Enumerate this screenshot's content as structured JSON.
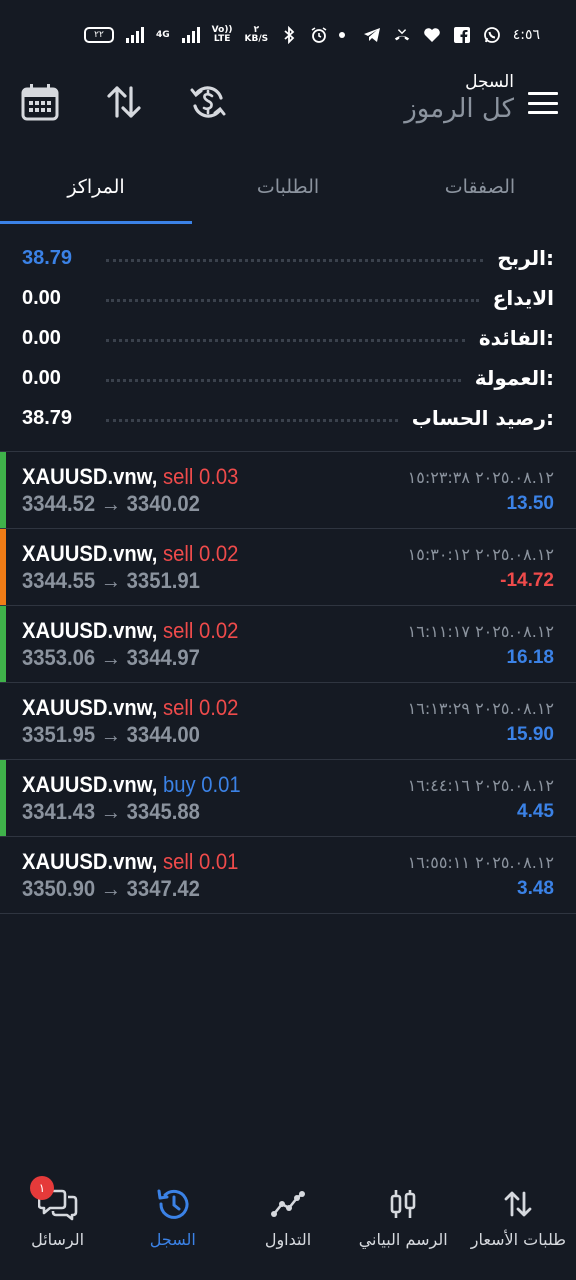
{
  "status_bar": {
    "time": "٤:٥٦",
    "battery": "٢٢",
    "net_top": "٢",
    "net_unit": "KB/S",
    "signal_label": "4G",
    "volte_top": "Vo))",
    "volte_bottom": "LTE"
  },
  "header": {
    "subtitle": "السجل",
    "title": "كل الرموز"
  },
  "tabs": [
    {
      "label": "الصفقات"
    },
    {
      "label": "الطلبات"
    },
    {
      "label": "المراكز"
    }
  ],
  "summary": [
    {
      "label": "الربح:",
      "value": "38.79",
      "value_color": "#3b82e6"
    },
    {
      "label": "الايداع",
      "value": "0.00",
      "value_color": "#ffffff"
    },
    {
      "label": "الفائدة:",
      "value": "0.00",
      "value_color": "#ffffff"
    },
    {
      "label": "العمولة:",
      "value": "0.00",
      "value_color": "#ffffff"
    },
    {
      "label": "رصيد الحساب:",
      "value": "38.79",
      "value_color": "#ffffff"
    }
  ],
  "deals": [
    {
      "symbol": "XAUUSD.vnw,",
      "side": "sell",
      "volume": "0.03",
      "open": "3344.52",
      "arrow": "→",
      "close": "3340.02",
      "datetime": "٢٠٢٥.٠٨.١٢ ١٥:٢٣:٣٨",
      "profit": "13.50",
      "bar_color": "#3fb24a"
    },
    {
      "symbol": "XAUUSD.vnw,",
      "side": "sell",
      "volume": "0.02",
      "open": "3344.55",
      "arrow": "→",
      "close": "3351.91",
      "datetime": "٢٠٢٥.٠٨.١٢ ١٥:٣٠:١٢",
      "profit": "-14.72",
      "bar_color": "#f07c16"
    },
    {
      "symbol": "XAUUSD.vnw,",
      "side": "sell",
      "volume": "0.02",
      "open": "3353.06",
      "arrow": "→",
      "close": "3344.97",
      "datetime": "٢٠٢٥.٠٨.١٢ ١٦:١١:١٧",
      "profit": "16.18",
      "bar_color": "#3fb24a"
    },
    {
      "symbol": "XAUUSD.vnw,",
      "side": "sell",
      "volume": "0.02",
      "open": "3351.95",
      "arrow": "→",
      "close": "3344.00",
      "datetime": "٢٠٢٥.٠٨.١٢ ١٦:١٣:٢٩",
      "profit": "15.90",
      "bar_color": ""
    },
    {
      "symbol": "XAUUSD.vnw,",
      "side": "buy",
      "volume": "0.01",
      "open": "3341.43",
      "arrow": "→",
      "close": "3345.88",
      "datetime": "٢٠٢٥.٠٨.١٢ ١٦:٤٤:١٦",
      "profit": "4.45",
      "bar_color": "#3fb24a"
    },
    {
      "symbol": "XAUUSD.vnw,",
      "side": "sell",
      "volume": "0.01",
      "open": "3350.90",
      "arrow": "→",
      "close": "3347.42",
      "datetime": "٢٠٢٥.٠٨.١٢ ١٦:٥٥:١١",
      "profit": "3.48",
      "bar_color": ""
    }
  ],
  "bottom_nav": [
    {
      "label": "طلبات الأسعار",
      "icon": "quotes-arrows-icon"
    },
    {
      "label": "الرسم البياني",
      "icon": "chart-candles-icon"
    },
    {
      "label": "التداول",
      "icon": "trade-line-icon"
    },
    {
      "label": "السجل",
      "icon": "history-clock-icon"
    },
    {
      "label": "الرسائل",
      "icon": "messages-chat-icon",
      "badge": "١"
    }
  ]
}
